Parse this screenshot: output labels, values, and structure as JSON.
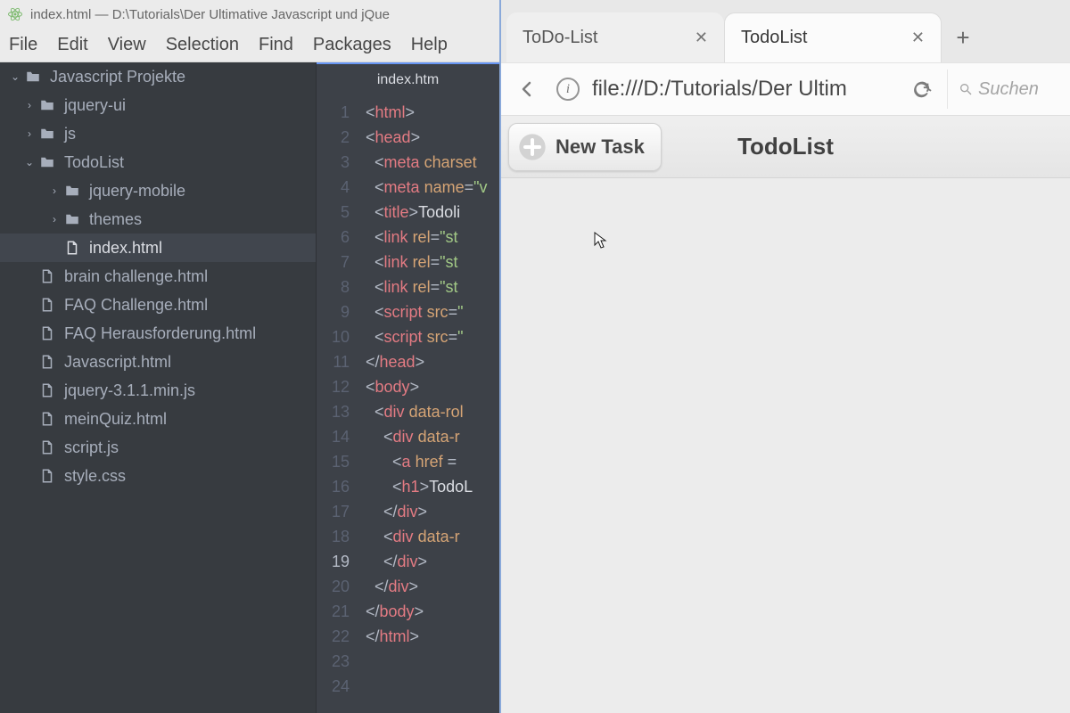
{
  "editor": {
    "title": "index.html — D:\\Tutorials\\Der Ultimative Javascript und jQue",
    "menubar": [
      "File",
      "Edit",
      "View",
      "Selection",
      "Find",
      "Packages",
      "Help"
    ],
    "tree": {
      "root": "Javascript Projekte",
      "items": [
        {
          "type": "folder",
          "name": "jquery-ui",
          "level": 1,
          "expando": "›"
        },
        {
          "type": "folder",
          "name": "js",
          "level": 1,
          "expando": "›"
        },
        {
          "type": "folder",
          "name": "TodoList",
          "level": 1,
          "expando": "⌄"
        },
        {
          "type": "folder",
          "name": "jquery-mobile",
          "level": 2,
          "expando": "›"
        },
        {
          "type": "folder",
          "name": "themes",
          "level": 2,
          "expando": "›"
        },
        {
          "type": "file",
          "name": "index.html",
          "level": 2,
          "selected": true
        },
        {
          "type": "file",
          "name": "brain challenge.html",
          "level": 1
        },
        {
          "type": "file",
          "name": "FAQ Challenge.html",
          "level": 1
        },
        {
          "type": "file",
          "name": "FAQ Herausforderung.html",
          "level": 1
        },
        {
          "type": "file",
          "name": "Javascript.html",
          "level": 1
        },
        {
          "type": "file",
          "name": "jquery-3.1.1.min.js",
          "level": 1
        },
        {
          "type": "file",
          "name": "meinQuiz.html",
          "level": 1
        },
        {
          "type": "file",
          "name": "script.js",
          "level": 1
        },
        {
          "type": "file",
          "name": "style.css",
          "level": 1
        }
      ]
    },
    "open_tab": "index.htm",
    "code_lines": [
      [
        [
          "p",
          "<"
        ],
        [
          "t",
          "html"
        ],
        [
          "p",
          ">"
        ]
      ],
      [
        [
          "p",
          "<"
        ],
        [
          "t",
          "head"
        ],
        [
          "p",
          ">"
        ]
      ],
      [
        [
          "s",
          "  "
        ],
        [
          "p",
          "<"
        ],
        [
          "t",
          "meta"
        ],
        [
          "s",
          " "
        ],
        [
          "a",
          "charset"
        ]
      ],
      [
        [
          "s",
          "  "
        ],
        [
          "p",
          "<"
        ],
        [
          "t",
          "meta"
        ],
        [
          "s",
          " "
        ],
        [
          "a",
          "name"
        ],
        [
          "p",
          "="
        ],
        [
          "str",
          "\"v"
        ]
      ],
      [
        [
          "s",
          "  "
        ],
        [
          "p",
          "<"
        ],
        [
          "t",
          "title"
        ],
        [
          "p",
          ">"
        ],
        [
          "x",
          "Todoli"
        ]
      ],
      [
        [
          "s",
          "  "
        ],
        [
          "p",
          "<"
        ],
        [
          "t",
          "link"
        ],
        [
          "s",
          " "
        ],
        [
          "a",
          "rel"
        ],
        [
          "p",
          "="
        ],
        [
          "str",
          "\"st"
        ]
      ],
      [
        [
          "s",
          "  "
        ],
        [
          "p",
          "<"
        ],
        [
          "t",
          "link"
        ],
        [
          "s",
          " "
        ],
        [
          "a",
          "rel"
        ],
        [
          "p",
          "="
        ],
        [
          "str",
          "\"st"
        ]
      ],
      [
        [
          "s",
          "  "
        ],
        [
          "p",
          "<"
        ],
        [
          "t",
          "link"
        ],
        [
          "s",
          " "
        ],
        [
          "a",
          "rel"
        ],
        [
          "p",
          "="
        ],
        [
          "str",
          "\"st"
        ]
      ],
      [
        [
          "s",
          "  "
        ],
        [
          "p",
          "<"
        ],
        [
          "t",
          "script"
        ],
        [
          "s",
          " "
        ],
        [
          "a",
          "src"
        ],
        [
          "p",
          "="
        ],
        [
          "str",
          "\""
        ]
      ],
      [
        [
          "s",
          "  "
        ],
        [
          "p",
          "<"
        ],
        [
          "t",
          "script"
        ],
        [
          "s",
          " "
        ],
        [
          "a",
          "src"
        ],
        [
          "p",
          "="
        ],
        [
          "str",
          "\""
        ]
      ],
      [
        [
          "p",
          "</"
        ],
        [
          "t",
          "head"
        ],
        [
          "p",
          ">"
        ]
      ],
      [
        [
          "p",
          "<"
        ],
        [
          "t",
          "body"
        ],
        [
          "p",
          ">"
        ]
      ],
      [
        [
          "s",
          "  "
        ],
        [
          "p",
          "<"
        ],
        [
          "t",
          "div"
        ],
        [
          "s",
          " "
        ],
        [
          "a",
          "data-rol"
        ]
      ],
      [
        [
          "s",
          "    "
        ],
        [
          "p",
          "<"
        ],
        [
          "t",
          "div"
        ],
        [
          "s",
          " "
        ],
        [
          "a",
          "data-r"
        ]
      ],
      [
        [
          "s",
          "      "
        ],
        [
          "p",
          "<"
        ],
        [
          "t",
          "a"
        ],
        [
          "s",
          " "
        ],
        [
          "a",
          "href"
        ],
        [
          "s",
          " ="
        ]
      ],
      [
        [
          "s",
          "      "
        ],
        [
          "p",
          "<"
        ],
        [
          "t",
          "h1"
        ],
        [
          "p",
          ">"
        ],
        [
          "x",
          "TodoL"
        ]
      ],
      [
        [
          "s",
          "    "
        ],
        [
          "p",
          "</"
        ],
        [
          "t",
          "div"
        ],
        [
          "p",
          ">"
        ]
      ],
      [
        [
          "s",
          "    "
        ],
        [
          "p",
          "<"
        ],
        [
          "t",
          "div"
        ],
        [
          "s",
          " "
        ],
        [
          "a",
          "data-r"
        ]
      ],
      [
        [
          "s",
          ""
        ]
      ],
      [
        [
          "s",
          "    "
        ],
        [
          "p",
          "</"
        ],
        [
          "t",
          "div"
        ],
        [
          "p",
          ">"
        ]
      ],
      [
        [
          "s",
          "  "
        ],
        [
          "p",
          "</"
        ],
        [
          "t",
          "div"
        ],
        [
          "p",
          ">"
        ]
      ],
      [
        [
          "p",
          "</"
        ],
        [
          "t",
          "body"
        ],
        [
          "p",
          ">"
        ]
      ],
      [
        [
          "p",
          "</"
        ],
        [
          "t",
          "html"
        ],
        [
          "p",
          ">"
        ]
      ],
      [
        [
          "s",
          ""
        ]
      ]
    ],
    "current_line": 19
  },
  "browser": {
    "tabs": [
      {
        "label": "ToDo-List",
        "active": false
      },
      {
        "label": "TodoList",
        "active": true
      }
    ],
    "url": "file:///D:/Tutorials/Der Ultim",
    "search_placeholder": "Suchen",
    "page": {
      "new_task": "New Task",
      "title": "TodoList"
    }
  }
}
